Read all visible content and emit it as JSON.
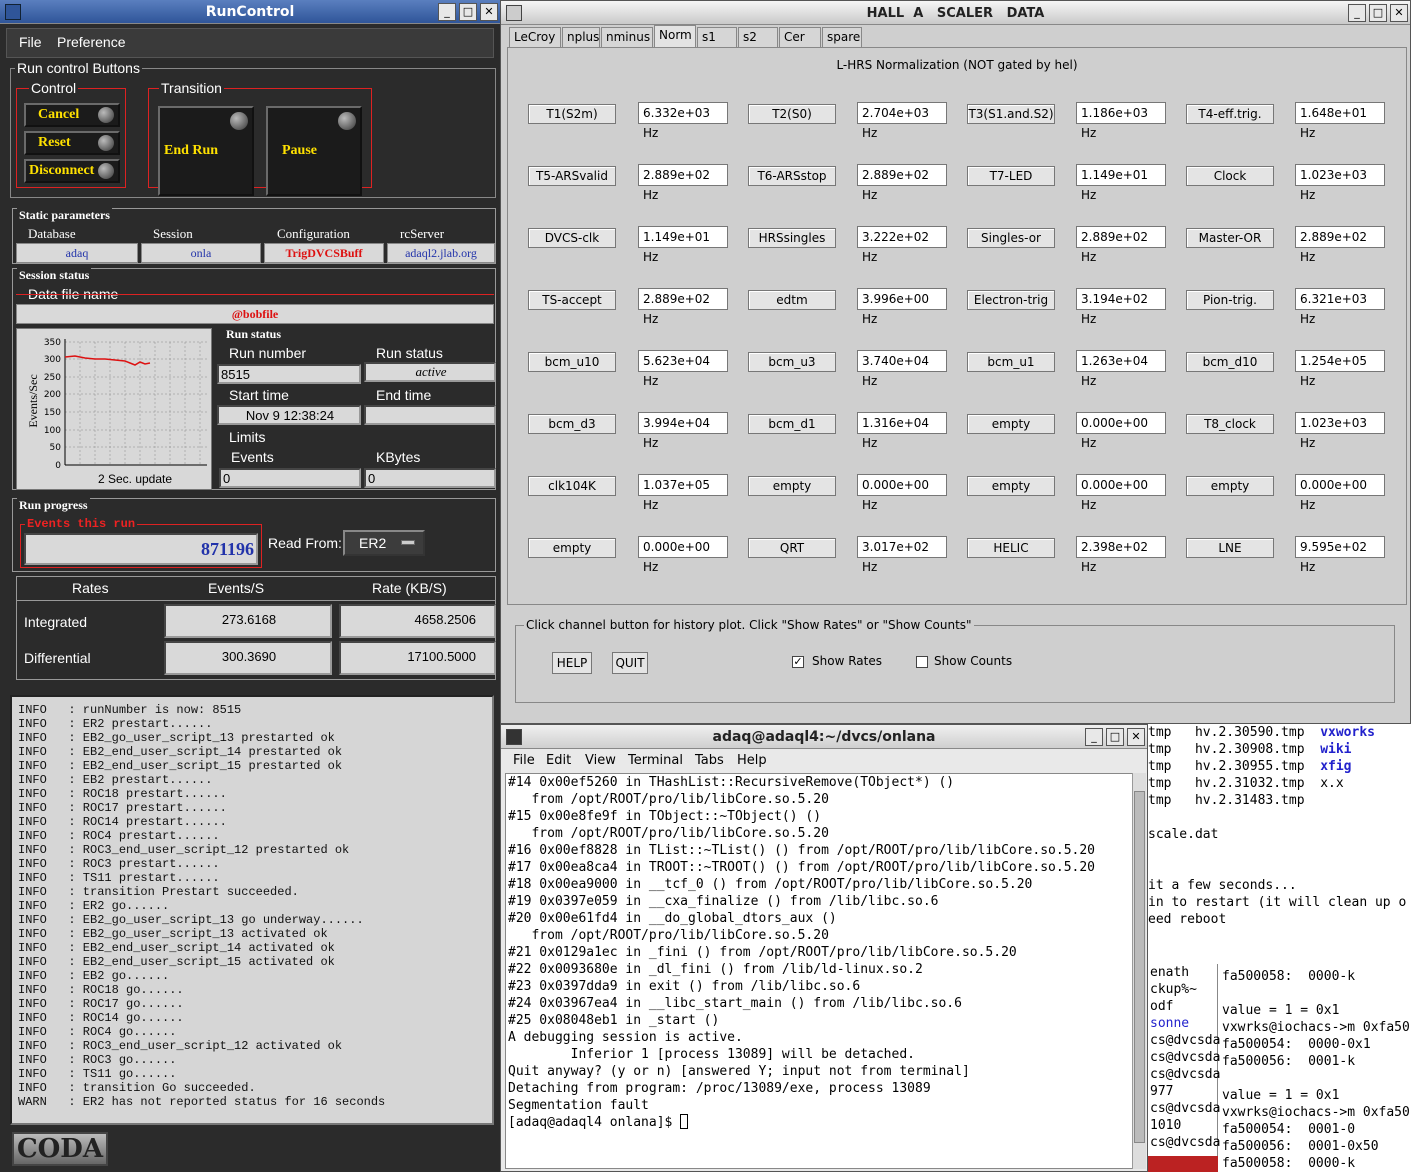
{
  "runcontrol": {
    "title": "RunControl",
    "menu": [
      "File",
      "Preference"
    ],
    "run_control_buttons": "Run control Buttons",
    "control_label": "Control",
    "transition_label": "Transition",
    "buttons": {
      "cancel": "Cancel",
      "reset": "Reset",
      "disconnect": "Disconnect",
      "end_run": "End Run",
      "pause": "Pause"
    },
    "static_params_label": "Static parameters",
    "params": {
      "database_h": "Database",
      "session_h": "Session",
      "config_h": "Configuration",
      "rcserver_h": "rcServer",
      "database": "adaq",
      "session": "onla",
      "config": "TrigDVCSBuff",
      "rcserver": "adaql2.jlab.org"
    },
    "session_status": "Session status",
    "data_file_label": "Data file name",
    "data_file": "@bobfile",
    "plot": {
      "ylabel": "Events/Sec",
      "xlabel": "2 Sec. update",
      "yticks": [
        "350",
        "300",
        "250",
        "200",
        "150",
        "100",
        "50",
        "0"
      ]
    },
    "run_status_label": "Run status",
    "run_number_label": "Run number",
    "run_number": "8515",
    "run_status_h": "Run status",
    "run_status": "active",
    "start_time_label": "Start time",
    "start_time": "Nov 9 12:38:24",
    "end_time_label": "End time",
    "end_time": "",
    "limits_label": "Limits",
    "events_label": "Events",
    "events": "0",
    "kbytes_label": "KBytes",
    "kbytes": "0",
    "run_progress_label": "Run progress",
    "events_this_run_label": "Events this run",
    "events_this_run": "871196",
    "read_from_label": "Read From:",
    "read_from": "ER2",
    "rates": {
      "h0": "Rates",
      "h1": "Events/S",
      "h2": "Rate (KB/S)",
      "integrated": "Integrated",
      "differential": "Differential",
      "int_ev": "273.6168",
      "int_kb": "4658.2506",
      "diff_ev": "300.3690",
      "diff_kb": "17100.5000"
    },
    "log": [
      "INFO   : runNumber is now: 8515",
      "INFO   : ER2 prestart......",
      "INFO   : EB2_go_user_script_13 prestarted ok",
      "INFO   : EB2_end_user_script_14 prestarted ok",
      "INFO   : EB2_end_user_script_15 prestarted ok",
      "INFO   : EB2 prestart......",
      "INFO   : ROC18 prestart......",
      "INFO   : ROC17 prestart......",
      "INFO   : ROC14 prestart......",
      "INFO   : ROC4 prestart......",
      "INFO   : ROC3_end_user_script_12 prestarted ok",
      "INFO   : ROC3 prestart......",
      "INFO   : TS11 prestart......",
      "INFO   : transition Prestart succeeded.",
      "INFO   : ER2 go......",
      "INFO   : EB2_go_user_script_13 go underway......",
      "INFO   : EB2_go_user_script_13 activated ok",
      "INFO   : EB2_end_user_script_14 activated ok",
      "INFO   : EB2_end_user_script_15 activated ok",
      "INFO   : EB2 go......",
      "INFO   : ROC18 go......",
      "INFO   : ROC17 go......",
      "INFO   : ROC14 go......",
      "INFO   : ROC4 go......",
      "INFO   : ROC3_end_user_script_12 activated ok",
      "INFO   : ROC3 go......",
      "INFO   : TS11 go......",
      "INFO   : transition Go succeeded.",
      "WARN   : ER2 has not reported status for 16 seconds"
    ],
    "logo": "CODA"
  },
  "scaler": {
    "title": "HALL  A   SCALER   DATA",
    "tabs": [
      "LeCroy",
      "nplus",
      "nminus",
      "Norm",
      "s1",
      "s2",
      "Cer",
      "spare"
    ],
    "heading": "L-HRS Normalization (NOT gated by hel)",
    "channels": [
      [
        "T1(S2m)",
        "6.332e+03 Hz",
        "T2(S0)",
        "2.704e+03 Hz",
        "T3(S1.and.S2)",
        "1.186e+03 Hz",
        "T4-eff.trig.",
        "1.648e+01 Hz"
      ],
      [
        "T5-ARSvalid",
        "2.889e+02 Hz",
        "T6-ARSstop",
        "2.889e+02 Hz",
        "T7-LED",
        "1.149e+01 Hz",
        "Clock",
        "1.023e+03 Hz"
      ],
      [
        "DVCS-clk",
        "1.149e+01 Hz",
        "HRSsingles",
        "3.222e+02 Hz",
        "Singles-or",
        "2.889e+02 Hz",
        "Master-OR",
        "2.889e+02 Hz"
      ],
      [
        "TS-accept",
        "2.889e+02 Hz",
        "edtm",
        "3.996e+00 Hz",
        "Electron-trig",
        "3.194e+02 Hz",
        "Pion-trig.",
        "6.321e+03 Hz"
      ],
      [
        "bcm_u10",
        "5.623e+04 Hz",
        "bcm_u3",
        "3.740e+04 Hz",
        "bcm_u1",
        "1.263e+04 Hz",
        "bcm_d10",
        "1.254e+05 Hz"
      ],
      [
        "bcm_d3",
        "3.994e+04 Hz",
        "bcm_d1",
        "1.316e+04 Hz",
        "empty",
        "0.000e+00 Hz",
        "T8_clock",
        "1.023e+03 Hz"
      ],
      [
        "clk104K",
        "1.037e+05 Hz",
        "empty",
        "0.000e+00 Hz",
        "empty",
        "0.000e+00 Hz",
        "empty",
        "0.000e+00 Hz"
      ],
      [
        "empty",
        "0.000e+00 Hz",
        "QRT",
        "3.017e+02 Hz",
        "HELIC",
        "2.398e+02 Hz",
        "LNE",
        "9.595e+02 Hz"
      ]
    ],
    "hint": "Click channel button for history plot.  Click \"Show Rates\" or \"Show Counts\"",
    "help": "HELP",
    "quit": "QUIT",
    "show_rates": "Show Rates",
    "show_counts": "Show Counts"
  },
  "terminal": {
    "title": "adaq@adaql4:~/dvcs/onlana",
    "menu": [
      "File",
      "Edit",
      "View",
      "Terminal",
      "Tabs",
      "Help"
    ],
    "lines": [
      "#14 0x00ef5260 in THashList::RecursiveRemove(TObject*) ()",
      "   from /opt/ROOT/pro/lib/libCore.so.5.20",
      "#15 0x00e8fe9f in TObject::~TObject() ()",
      "   from /opt/ROOT/pro/lib/libCore.so.5.20",
      "#16 0x00ef8828 in TList::~TList() () from /opt/ROOT/pro/lib/libCore.so.5.20",
      "#17 0x00ea8ca4 in TROOT::~TROOT() () from /opt/ROOT/pro/lib/libCore.so.5.20",
      "#18 0x00ea9000 in __tcf_0 () from /opt/ROOT/pro/lib/libCore.so.5.20",
      "#19 0x0397e059 in __cxa_finalize () from /lib/libc.so.6",
      "#20 0x00e61fd4 in __do_global_dtors_aux ()",
      "   from /opt/ROOT/pro/lib/libCore.so.5.20",
      "#21 0x0129a1ec in _fini () from /opt/ROOT/pro/lib/libCore.so.5.20",
      "#22 0x0093680e in _dl_fini () from /lib/ld-linux.so.2",
      "#23 0x0397dda9 in exit () from /lib/libc.so.6",
      "#24 0x03967ea4 in __libc_start_main () from /lib/libc.so.6",
      "#25 0x08048eb1 in _start ()",
      "A debugging session is active.",
      "",
      "        Inferior 1 [process 13089] will be detached.",
      "",
      "Quit anyway? (y or n) [answered Y; input not from terminal]",
      "Detaching from program: /proc/13089/exe, process 13089",
      "Segmentation fault",
      "[adaq@adaql4 onlana]$ "
    ]
  },
  "bg_terminal": {
    "top_lines": [
      [
        "tmp   hv.2.30590.tmp  ",
        "vxworks"
      ],
      [
        "tmp   hv.2.30908.tmp  ",
        "wiki"
      ],
      [
        "tmp   hv.2.30955.tmp  ",
        "xfig"
      ],
      [
        "tmp   hv.2.31032.tmp  ",
        "x.x"
      ],
      [
        "tmp   hv.2.31483.tmp  ",
        ""
      ]
    ],
    "mid_lines": [
      "",
      "scale.dat",
      "",
      "",
      "it a few seconds...",
      "in to restart (it will clean up o",
      "eed reboot"
    ],
    "left_lines": [
      "enath",
      "ckup%~",
      "odf",
      "sonne",
      "cs@dvcsda",
      "cs@dvcsda",
      "cs@dvcsda",
      "977",
      "cs@dvcsda",
      "1010",
      "cs@dvcsda"
    ],
    "right_lines": [
      "fa500058:  0000-k",
      "",
      "value = 1 = 0x1",
      "vxwrks@iochacs->m 0xfa50",
      "fa500054:  0000-0x1",
      "fa500056:  0001-k",
      "",
      "value = 1 = 0x1",
      "vxwrks@iochacs->m 0xfa50",
      "fa500054:  0001-0",
      "fa500056:  0001-0x50",
      "fa500058:  0000-k"
    ]
  },
  "colors": {
    "rc_bg": "#2b2b2b",
    "yellow_label": "#ffe100",
    "red_border": "#dd2222",
    "scaler_bg": "#cfcfcf",
    "link_blue": "#2222cc"
  }
}
